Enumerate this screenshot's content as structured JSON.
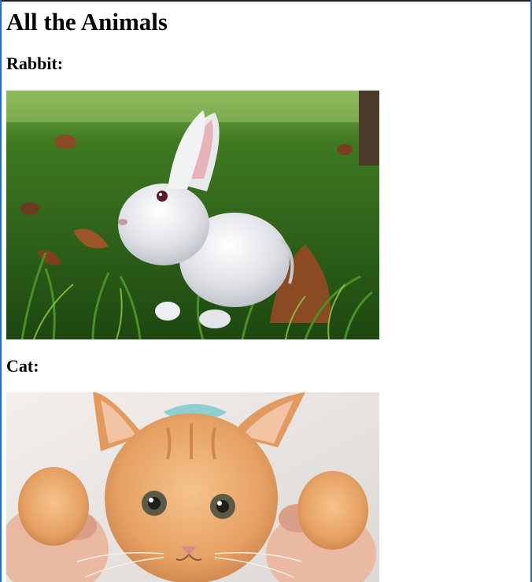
{
  "page": {
    "title": "All the Animals",
    "sections": [
      {
        "heading": "Rabbit:",
        "image_subject": "white rabbit in grass"
      },
      {
        "heading": "Cat:",
        "image_subject": "orange kitten held in hands"
      }
    ]
  },
  "colors": {
    "frame_accent": "#1b6fd1",
    "grass": "#2f6a1c",
    "rabbit_fur": "#e6e7ea",
    "kitten_fur": "#e7a565"
  }
}
